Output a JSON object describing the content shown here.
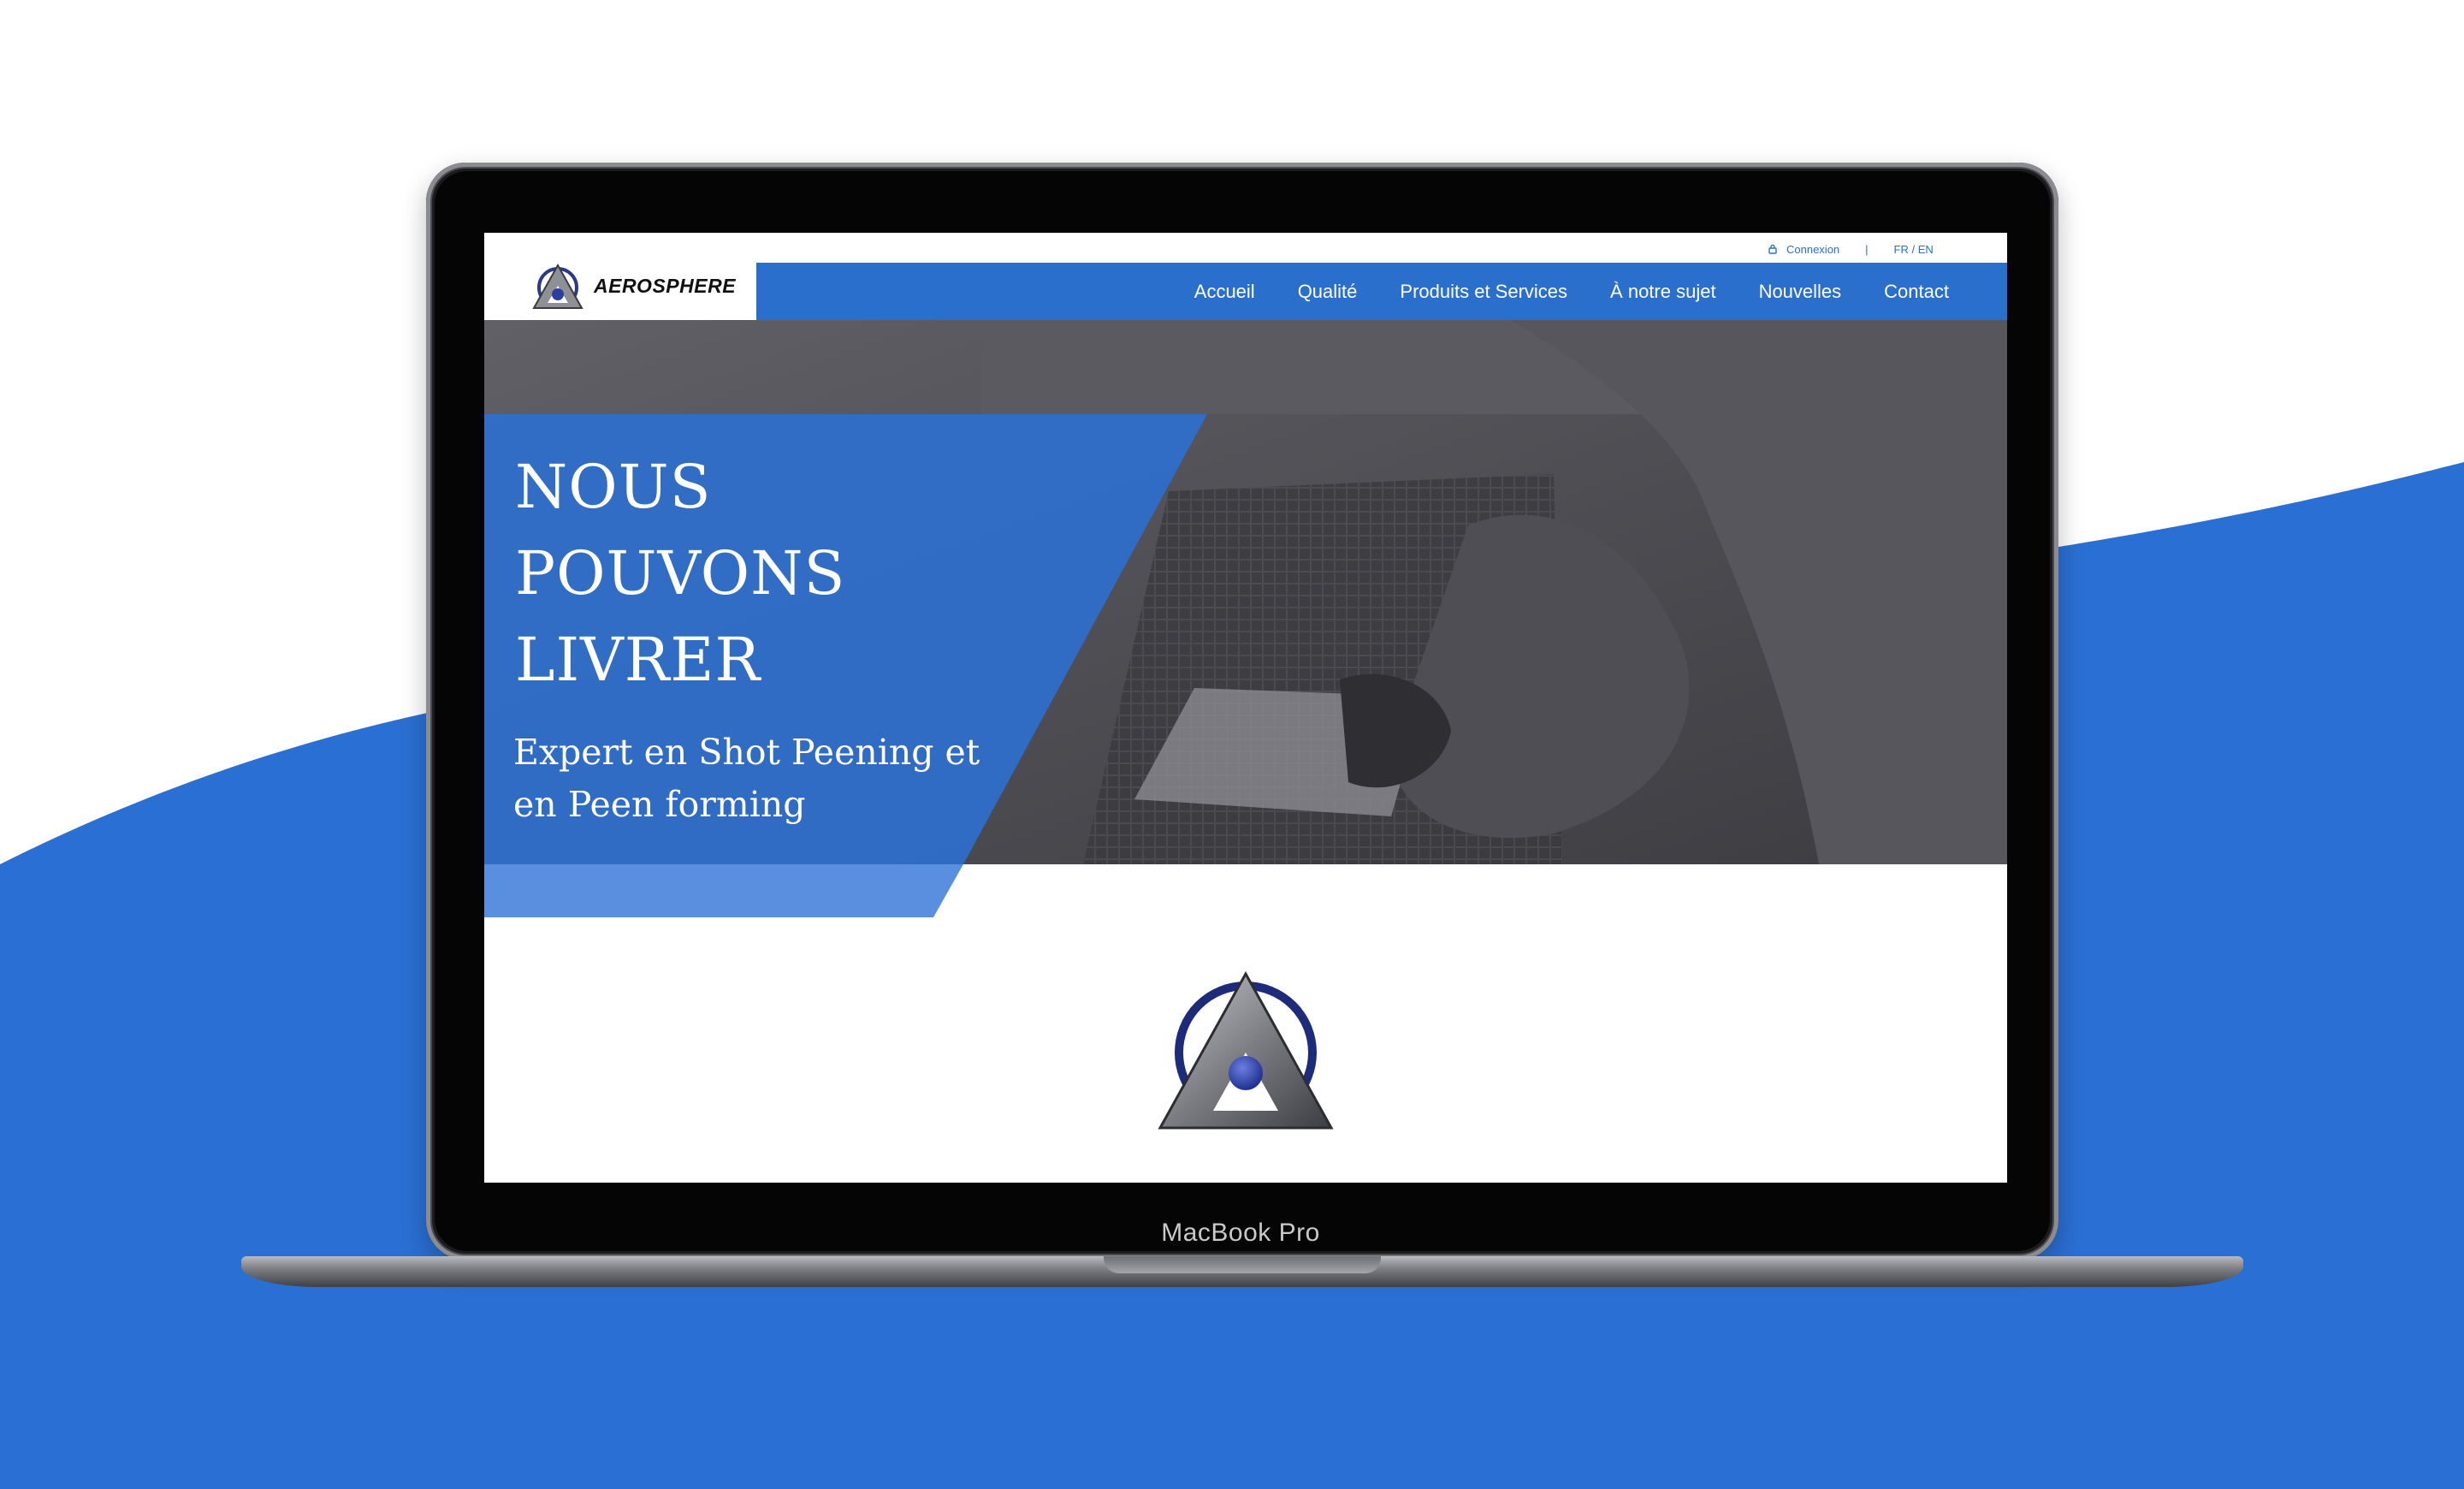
{
  "device": {
    "label": "MacBook Pro"
  },
  "site": {
    "brand": "AEROSPHERE",
    "topbar": {
      "login": "Connexion",
      "separator": "|",
      "language": "FR / EN"
    },
    "nav": [
      "Accueil",
      "Qualité",
      "Produits et Services",
      "À notre sujet",
      "Nouvelles",
      "Contact"
    ],
    "hero": {
      "title_lines": [
        "NOUS",
        "POUVONS",
        "LIVRER"
      ],
      "subtitle_lines": [
        "Expert en Shot Peening et",
        "en Peen forming"
      ]
    }
  },
  "colors": {
    "brand_blue": "#2a6fcc",
    "panel_blue": "#2e6fd0",
    "stripe_blue": "#5a8fe0",
    "background_blue": "#2a6fd3"
  },
  "icons": [
    "lock-icon",
    "aerosphere-logo"
  ]
}
